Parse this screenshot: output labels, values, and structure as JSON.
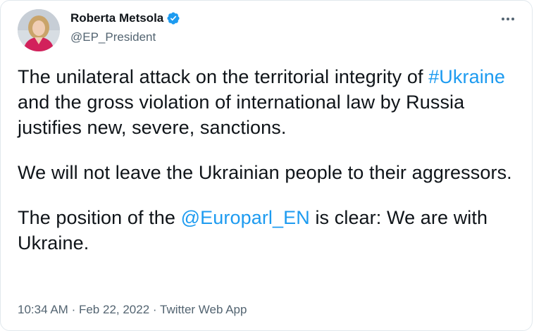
{
  "author": {
    "name": "Roberta Metsola",
    "handle": "@EP_President",
    "verified": true,
    "verified_icon": "verified-badge-icon",
    "avatar_icon": "avatar"
  },
  "more_icon": "more-options-icon",
  "tweet": {
    "p1_before": "The unilateral attack on the territorial integrity of ",
    "p1_link": "#Ukraine",
    "p1_after": " and the gross violation of international law by Russia justifies new, severe, sanctions.",
    "p2": "We will not leave the Ukrainian people to their aggressors.",
    "p3_before": "The position of the ",
    "p3_link": "@Europarl_EN",
    "p3_after": " is clear: We are with Ukraine.",
    "flag_icon": "ukraine-flag-icon"
  },
  "meta": {
    "time": "10:34 AM",
    "separator": "·",
    "date": "Feb 22, 2022",
    "source": "Twitter Web App"
  },
  "colors": {
    "link": "#1d9bf0",
    "secondary_text": "#536471",
    "primary_text": "#0f1419",
    "flag_blue": "#0057b7",
    "flag_yellow": "#ffd700",
    "border": "#e1e8ed"
  }
}
